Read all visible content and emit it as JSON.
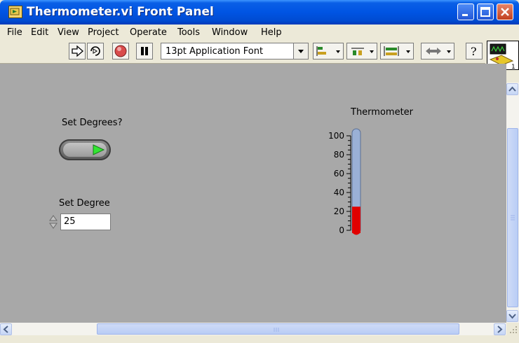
{
  "window": {
    "title": "Thermometer.vi Front Panel"
  },
  "menu": {
    "items": [
      {
        "label": "File"
      },
      {
        "label": "Edit"
      },
      {
        "label": "View"
      },
      {
        "label": "Project"
      },
      {
        "label": "Operate"
      },
      {
        "label": "Tools"
      },
      {
        "label": "Window"
      },
      {
        "label": "Help"
      }
    ]
  },
  "toolbar": {
    "font_ring": "13pt Application Font",
    "tools": [
      "run-arrow-icon",
      "run-continuously-icon",
      "abort-execution-icon",
      "pause-icon",
      "align-objects-icon",
      "distribute-objects-icon",
      "resize-objects-icon",
      "reorder-icon",
      "context-help-icon"
    ]
  },
  "vi_icon": {
    "connector_label": "1"
  },
  "panel": {
    "boolean_control": {
      "label": "Set Degrees?",
      "value": true
    },
    "numeric_control": {
      "label": "Set Degree",
      "value": "25"
    },
    "thermometer": {
      "label": "Thermometer",
      "scale": [
        "100",
        "80",
        "60",
        "40",
        "20",
        "0"
      ],
      "min": 0,
      "max": 100,
      "value": 25,
      "fill_color": "#e00000",
      "empty_color": "#9ab0d6"
    }
  },
  "colors": {
    "panel_bg": "#a8a8a8",
    "titlebar": "#0054e3",
    "chrome": "#ece9d8"
  }
}
